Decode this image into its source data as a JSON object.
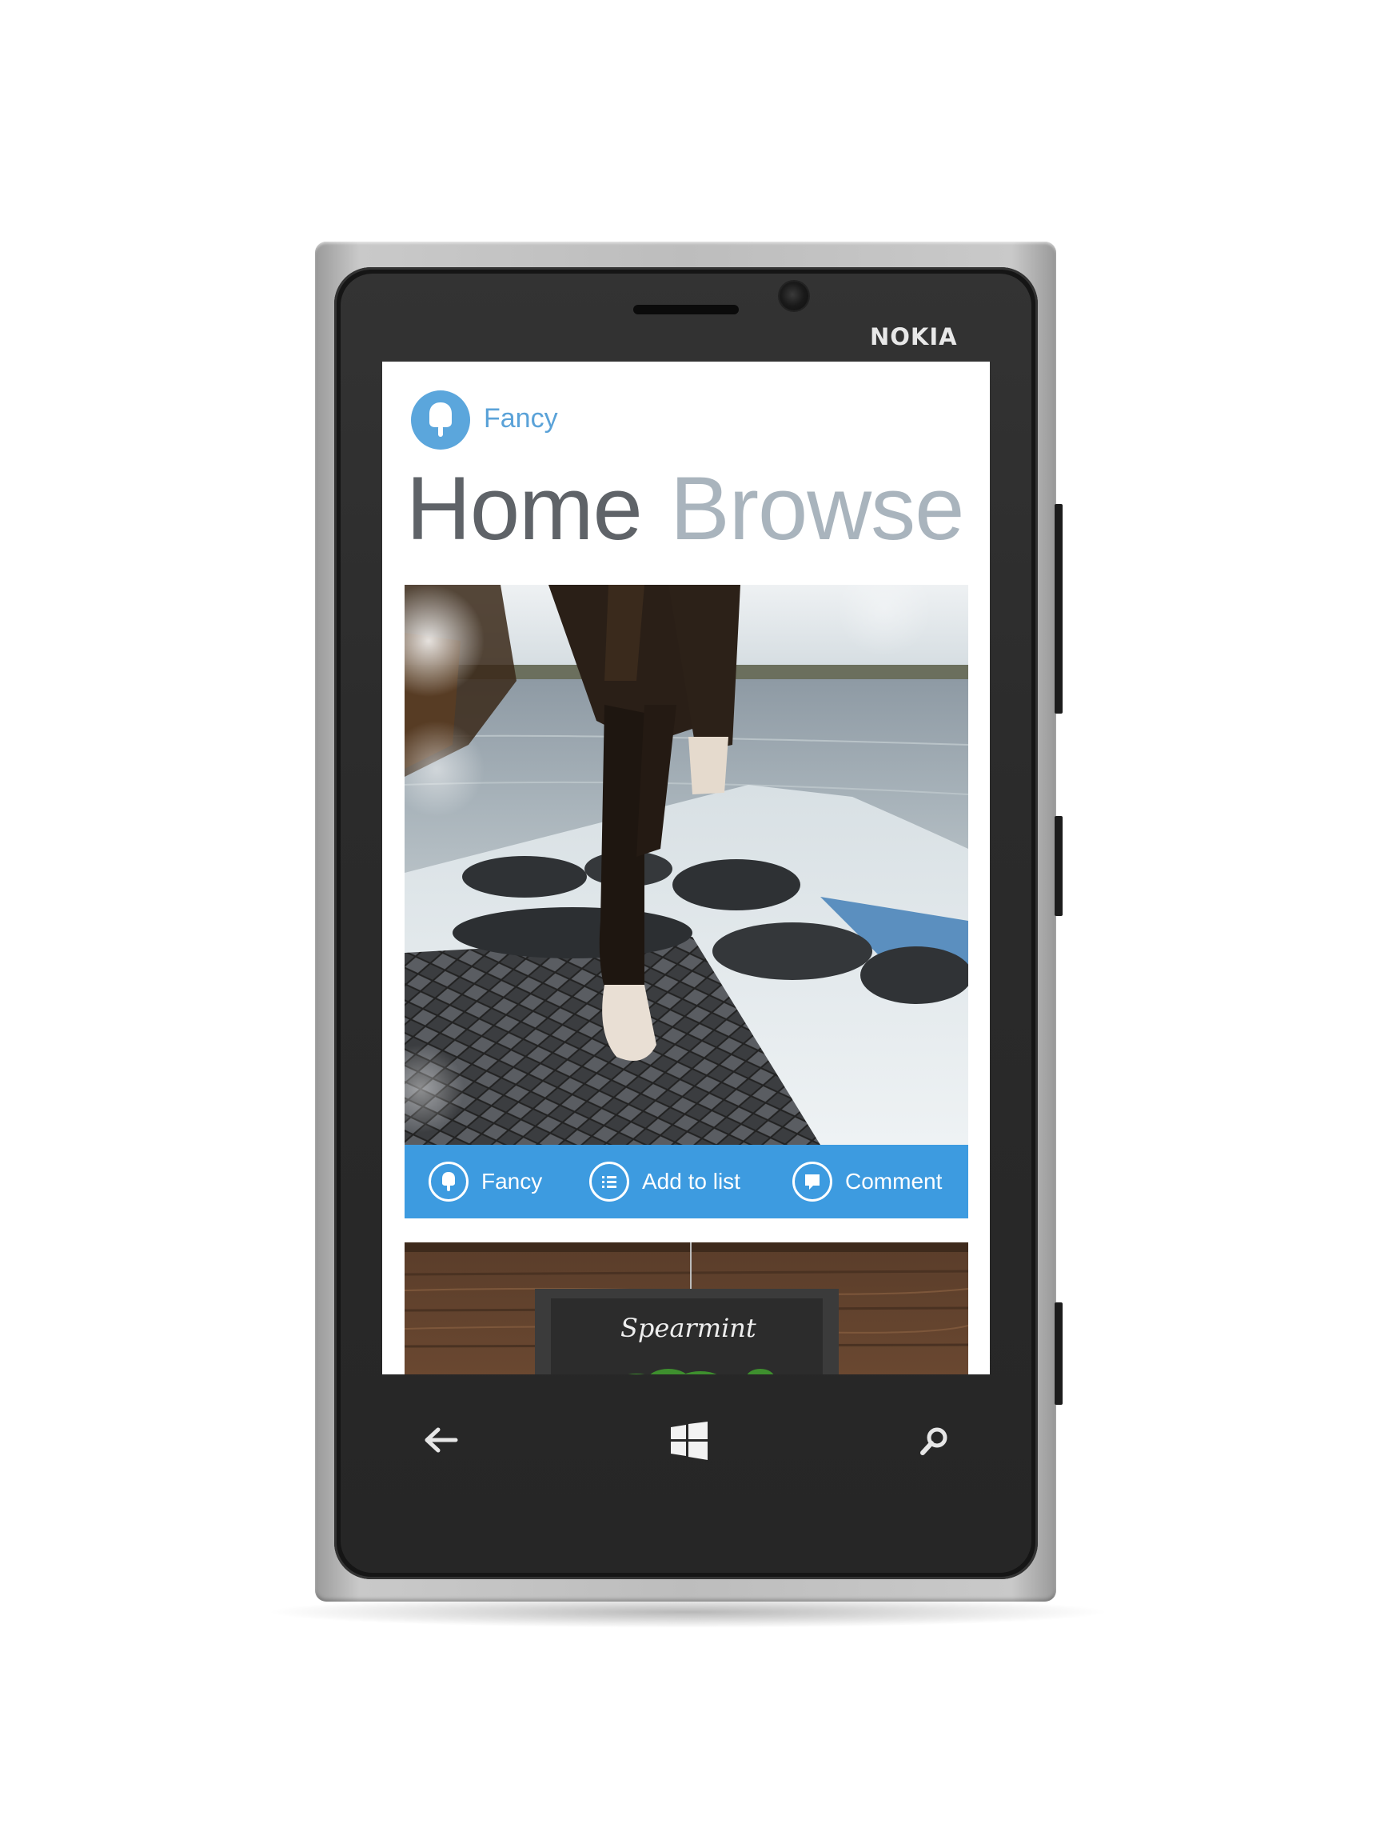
{
  "device": {
    "brand": "NOKIA"
  },
  "app": {
    "name": "Fancy"
  },
  "pivot": {
    "items": [
      {
        "label": "Home"
      },
      {
        "label": "Browse"
      }
    ]
  },
  "feed": {
    "items": [
      {
        "actions": [
          {
            "label": "Fancy",
            "icon": "fancy-icon"
          },
          {
            "label": "Add to list",
            "icon": "list-icon"
          },
          {
            "label": "Comment",
            "icon": "comment-icon"
          }
        ]
      },
      {
        "sign_text": "Spearmint"
      }
    ]
  },
  "navbar": {
    "back_icon": "back-arrow-icon",
    "start_icon": "windows-logo-icon",
    "search_icon": "search-icon"
  },
  "colors": {
    "accent": "#3d9be0",
    "logo": "#5ba6dc",
    "app_name": "#5aa2d8",
    "pivot_active": "#5f6368",
    "pivot_inactive": "#a9b4bd"
  }
}
